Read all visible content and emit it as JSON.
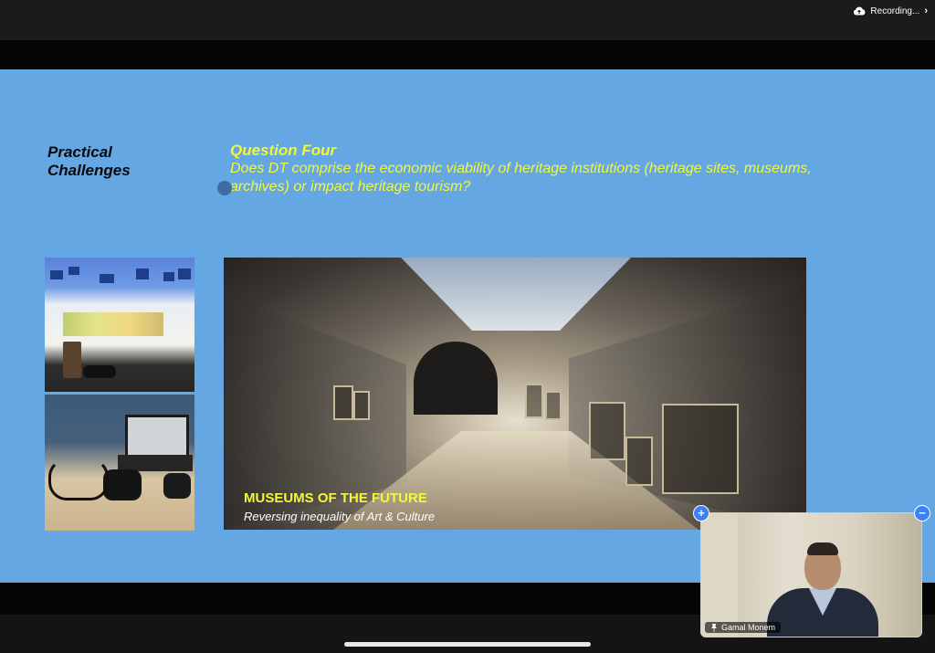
{
  "status_bar": {
    "recording_label": "Recording...",
    "cloud_icon": "cloud-upload-icon",
    "chevron_icon": "chevron-right-icon"
  },
  "slide": {
    "left_heading_line1": "Practical",
    "left_heading_line2": "Challenges",
    "question_title": "Question Four",
    "question_body": "Does DT comprise the economic viability of heritage institutions (heritage sites, museums, archives) or impact heritage tourism?",
    "image_caption_title": "MUSEUMS OF THE FUTURE",
    "image_caption_subtitle": "Reversing inequality of Art & Culture",
    "background_color": "#64a7e3",
    "accent_color": "#f3f73a"
  },
  "video_tile": {
    "participant_name": "Gamal Monem",
    "pin_icon": "pin-icon",
    "expand_label": "+",
    "collapse_label": "−"
  }
}
